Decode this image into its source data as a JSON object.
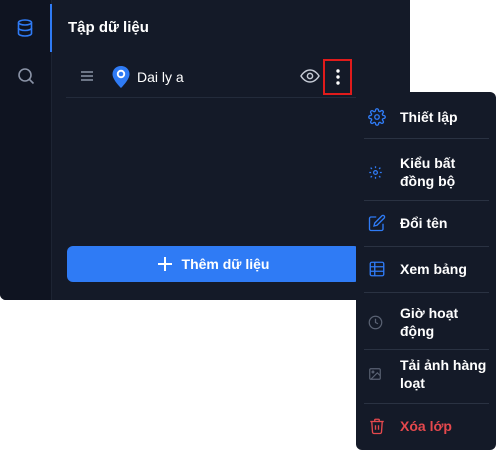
{
  "panel": {
    "title": "Tập dữ liệu",
    "add_button_label": "Thêm dữ liệu"
  },
  "rail": {
    "items": [
      {
        "icon": "database-icon",
        "active": true
      },
      {
        "icon": "search-icon",
        "active": false
      }
    ]
  },
  "layer": {
    "name": "Dai ly a"
  },
  "menu": {
    "items": [
      {
        "label": "Thiết lập",
        "icon": "gear-icon"
      },
      {
        "label": "Kiểu bất đồng bộ",
        "icon": "sync-settings-icon"
      },
      {
        "label": "Đổi tên",
        "icon": "edit-icon"
      },
      {
        "label": "Xem bảng",
        "icon": "table-icon"
      },
      {
        "label": "Giờ hoạt động",
        "icon": "clock-icon"
      },
      {
        "label": "Tải ảnh hàng loạt",
        "icon": "image-icon"
      },
      {
        "label": "Xóa lớp",
        "icon": "trash-icon"
      }
    ]
  },
  "colors": {
    "accent": "#2f7bf5",
    "danger": "#e5484d",
    "panel_bg": "#141a28",
    "highlight_box": "#e01b1b"
  }
}
